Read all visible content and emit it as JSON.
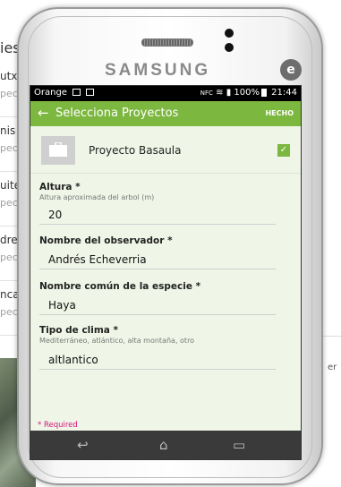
{
  "background": {
    "title": "ies",
    "items": [
      {
        "title": "utxi",
        "sub": "pec"
      },
      {
        "title": "nis",
        "sub": "pec"
      },
      {
        "title": "uites",
        "sub": "pec"
      },
      {
        "title": "dres",
        "sub": "pec"
      },
      {
        "title": "ncali",
        "sub": "pec"
      }
    ],
    "right_text": "er"
  },
  "device": {
    "brand": "SAMSUNG",
    "logo": "e"
  },
  "status": {
    "carrier": "Orange",
    "battery": "100%",
    "time": "21:44",
    "extra": "NFC"
  },
  "appbar": {
    "back_icon": "←",
    "title": "Selecciona Proyectos",
    "done_label": "HECHO"
  },
  "project": {
    "name": "Proyecto Basaula",
    "checked_icon": "✓"
  },
  "fields": [
    {
      "label": "Altura *",
      "hint": "Altura aproximada del arbol (m)",
      "value": "20"
    },
    {
      "label": "Nombre del observador *",
      "hint": "",
      "value": "Andrés Echeverria"
    },
    {
      "label": "Nombre común de la especie *",
      "hint": "",
      "value": "Haya"
    },
    {
      "label": "Tipo de clima *",
      "hint": "Mediterráneo, atlántico, alta montaña, otro",
      "value": "altlantico"
    }
  ],
  "required_note": "* Required",
  "nav": {
    "back_icon": "↩",
    "home_icon": "⌂",
    "recent_icon": "▭"
  },
  "colors": {
    "accent": "#7cb73f",
    "content_bg": "#f0f6e7",
    "required": "#d6147a"
  }
}
